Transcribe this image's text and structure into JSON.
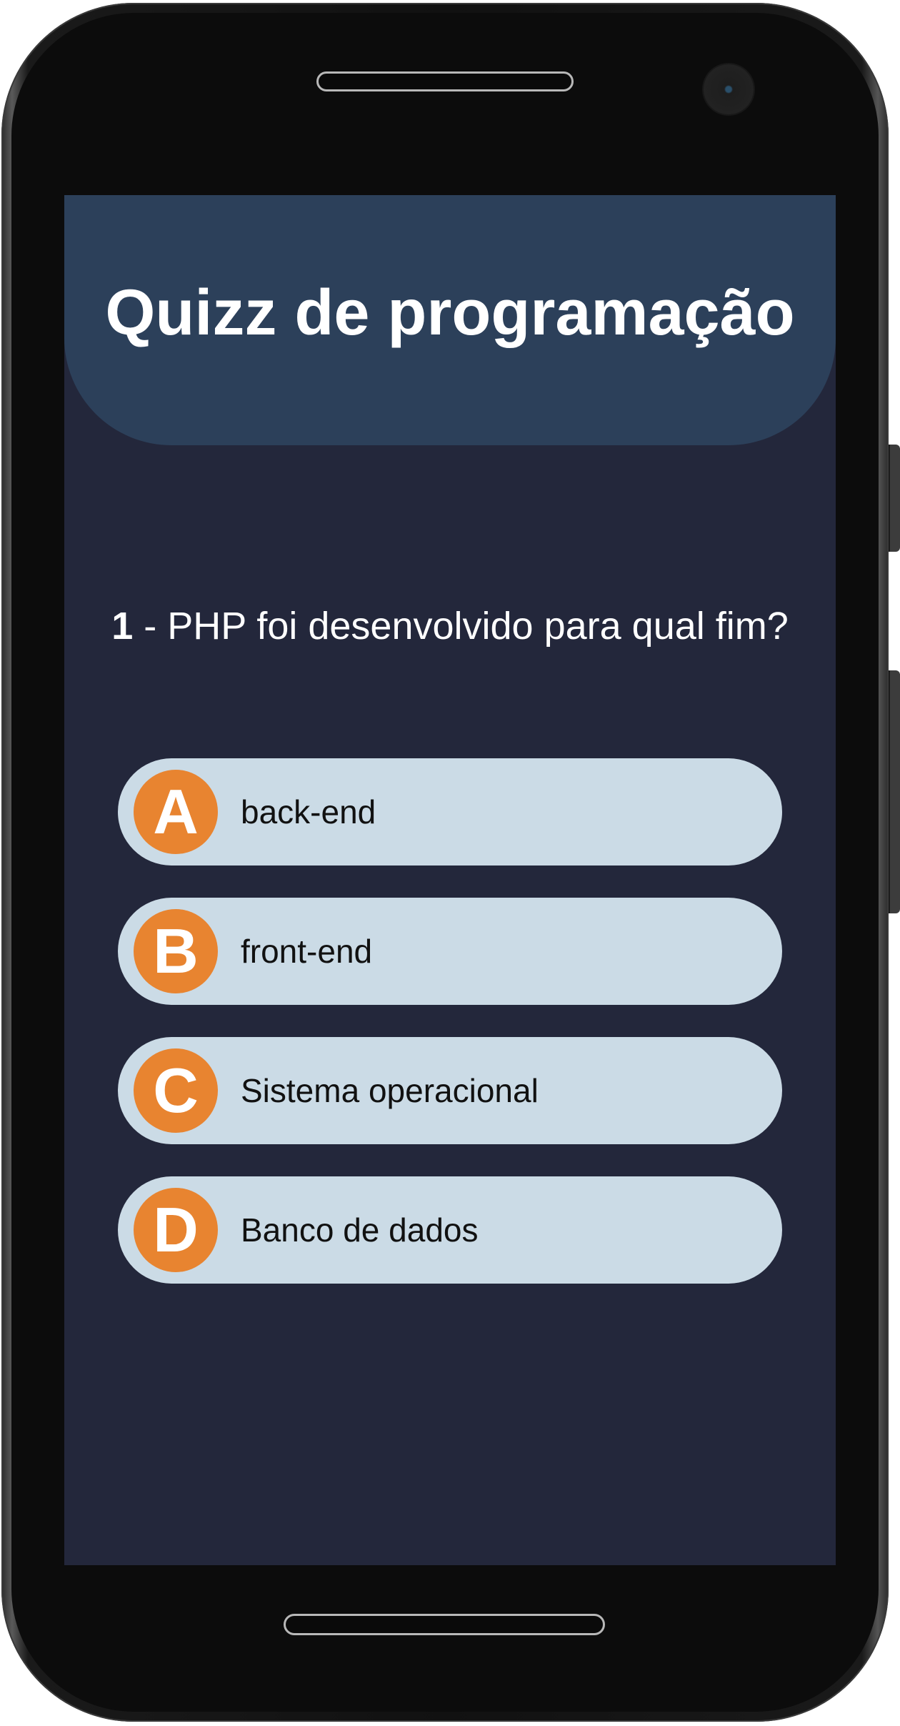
{
  "app": {
    "title": "Quizz de programação"
  },
  "question": {
    "number": "1",
    "separator": " - ",
    "text": "PHP foi desenvolvido para qual fim?"
  },
  "options": [
    {
      "letter": "A",
      "text": "back-end"
    },
    {
      "letter": "B",
      "text": "front-end"
    },
    {
      "letter": "C",
      "text": "Sistema operacional"
    },
    {
      "letter": "D",
      "text": "Banco de dados"
    }
  ],
  "colors": {
    "header": "#2c405a",
    "background": "#23273b",
    "option_bg": "#cbdbe6",
    "letter_badge": "#e88430"
  }
}
